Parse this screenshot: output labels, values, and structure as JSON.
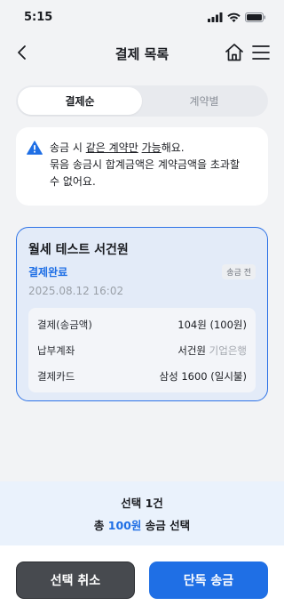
{
  "status_bar": {
    "time": "5:15"
  },
  "header": {
    "title": "결제 목록"
  },
  "tabs": [
    {
      "label": "결제순",
      "active": true
    },
    {
      "label": "계약별",
      "active": false
    }
  ],
  "notice": {
    "line1_prefix": "송금 시 ",
    "line1_underlined1": "같은 계약만",
    "line1_space": " ",
    "line1_underlined2": "가능",
    "line1_suffix": "해요.",
    "line2": "묶음 송금시 합계금액은 계약금액을 초과할",
    "line3": "수 없어요."
  },
  "payment_card": {
    "title": "월세 테스트 서건원",
    "status": "결제완료",
    "badge": "송금 전",
    "date": "2025.08.12 16:02",
    "details": [
      {
        "label": "결제(송금액)",
        "value": "104원 (100원)",
        "muted": ""
      },
      {
        "label": "납부계좌",
        "value": "서건원 ",
        "muted": "기업은행"
      },
      {
        "label": "결제카드",
        "value": "삼성 1600 (일시불)",
        "muted": ""
      }
    ]
  },
  "summary": {
    "line1": "선택 1건",
    "prefix": "총 ",
    "amount": "100원",
    "suffix": " 송금 선택"
  },
  "buttons": {
    "cancel": "선택 취소",
    "send": "단독 송금"
  },
  "colors": {
    "accent": "#1f6fe5",
    "card_bg": "#e3ebf8",
    "warning": "#1f6fe5"
  },
  "icons": [
    "signal-icon",
    "wifi-icon",
    "battery-icon",
    "back-arrow-icon",
    "home-icon",
    "menu-icon",
    "warning-icon"
  ]
}
